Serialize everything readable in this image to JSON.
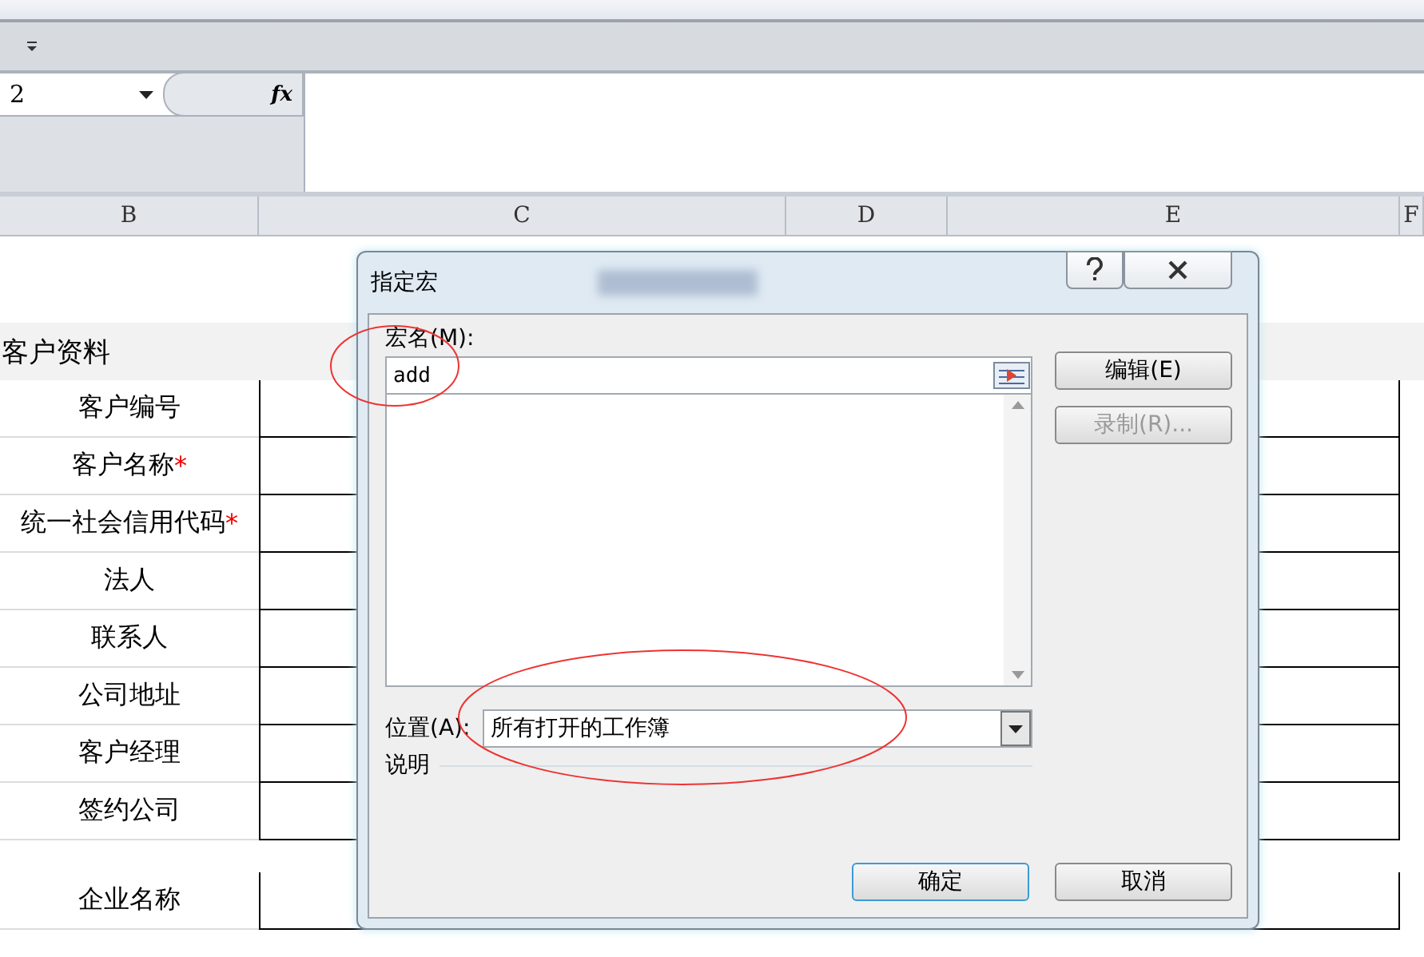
{
  "formula_bar": {
    "name_box": "2",
    "fx": "fx"
  },
  "columns": [
    "B",
    "C",
    "D",
    "E",
    "F"
  ],
  "rows": [
    {
      "kind": "empty"
    },
    {
      "kind": "section",
      "label": "客户资料"
    },
    {
      "kind": "field",
      "label": "客户编号"
    },
    {
      "kind": "field",
      "label": "客户名称",
      "required_mark": "*"
    },
    {
      "kind": "field",
      "label": "统一社会信用代码",
      "required_mark": "*"
    },
    {
      "kind": "field",
      "label": "法人"
    },
    {
      "kind": "field",
      "label": "联系人"
    },
    {
      "kind": "field",
      "label": "公司地址"
    },
    {
      "kind": "field",
      "label": "客户经理"
    },
    {
      "kind": "field",
      "label": "签约公司"
    },
    {
      "kind": "spacer"
    },
    {
      "kind": "field",
      "label": "企业名称"
    }
  ],
  "dialog": {
    "title": "指定宏",
    "macro_name_label": "宏名(M):",
    "macro_name": "add",
    "side_buttons": [
      {
        "label": "编辑(E)",
        "disabled": false
      },
      {
        "label": "录制(R)...",
        "disabled": true
      }
    ],
    "location_label": "位置(A):",
    "location": "所有打开的工作簿",
    "description_label": "说明",
    "footer_buttons": [
      {
        "label": "确定",
        "default": true
      },
      {
        "label": "取消",
        "default": false
      }
    ]
  }
}
